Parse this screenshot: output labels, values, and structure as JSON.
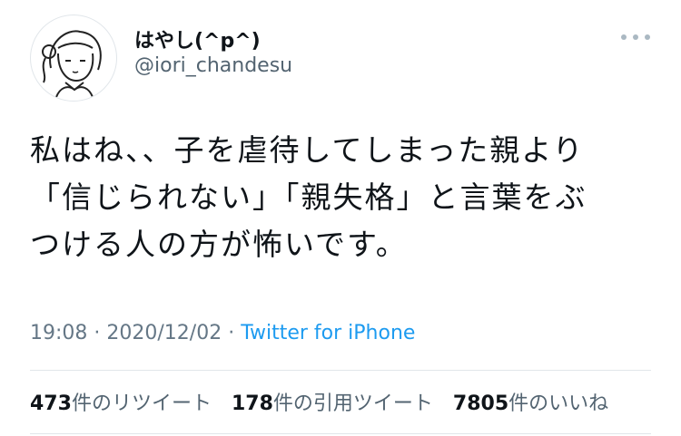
{
  "user": {
    "display_name": "はやし(^p^)",
    "handle": "@iori_chandesu",
    "avatar_icon": "illustrated-girl-avatar"
  },
  "tweet": {
    "text": "私はね、、子を虐待してしまった親より\n「信じられない」「親失格」と言葉をぶ\nつける人の方が怖いです。",
    "time": "19:08",
    "sep1": " · ",
    "date": "2020/12/02",
    "sep2": " · ",
    "source": "Twitter for iPhone"
  },
  "stats": {
    "retweets_count": "473",
    "retweets_label": "件のリツイート",
    "quotes_count": "178",
    "quotes_label": "件の引用ツイート",
    "likes_count": "7805",
    "likes_label": "件のいいね"
  },
  "colors": {
    "link": "#1d9bf0",
    "secondary_text": "#657786",
    "divider": "#e1e6ea"
  }
}
